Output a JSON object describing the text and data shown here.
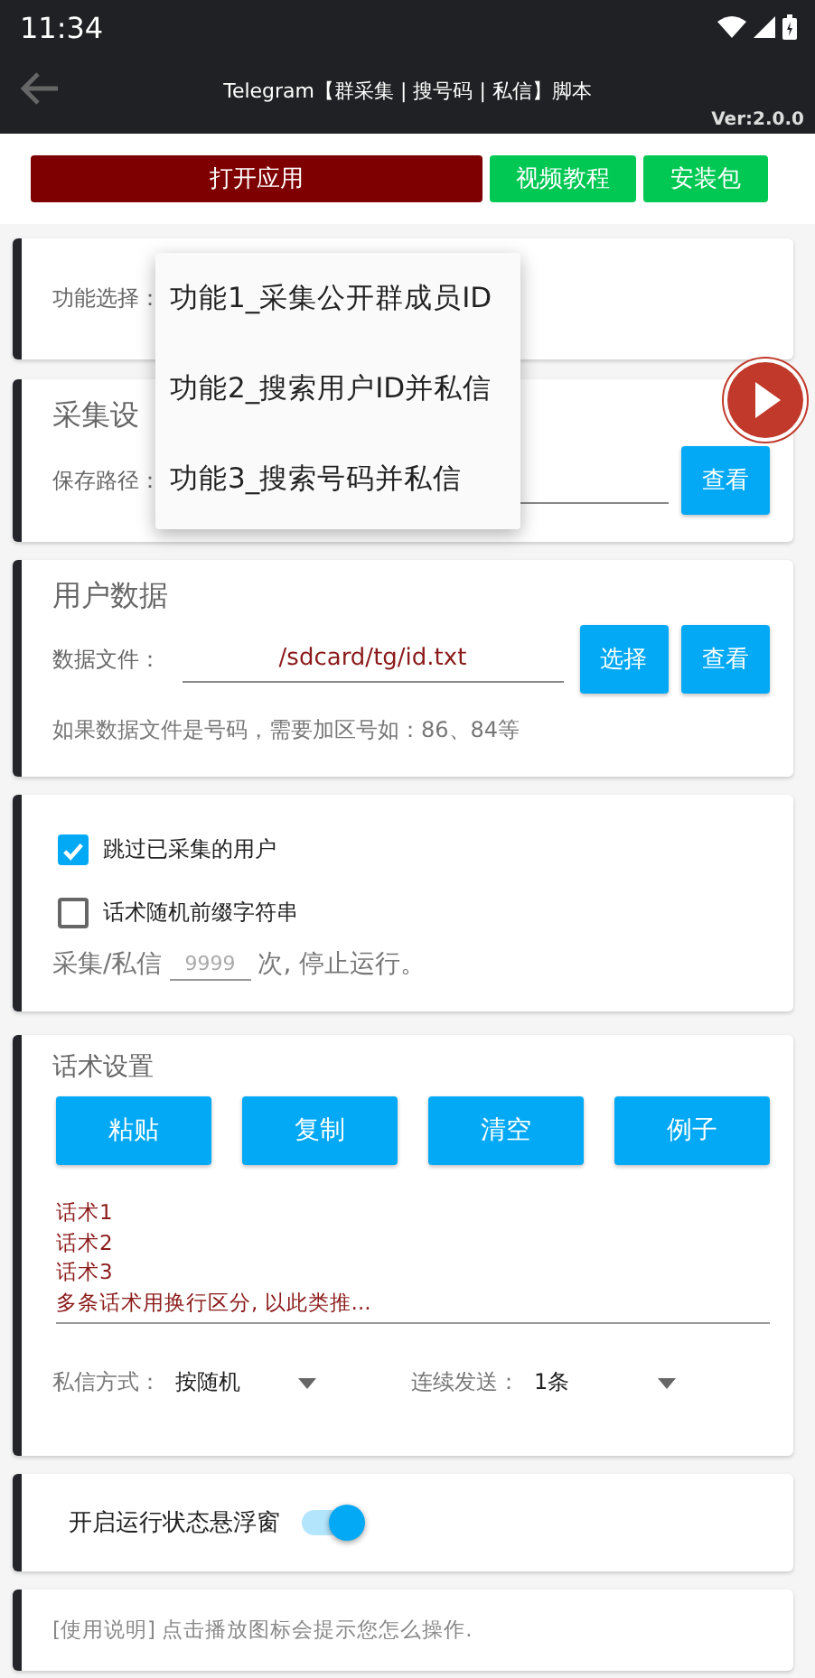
{
  "status_bar": {
    "time": "11:34"
  },
  "app_bar": {
    "title": "Telegram【群采集 | 搜号码 | 私信】脚本",
    "version": "Ver:2.0.0"
  },
  "top_buttons": [
    {
      "label": "打开应用",
      "kind": "primary"
    },
    {
      "label": "视频教程",
      "kind": "success"
    },
    {
      "label": "安装包",
      "kind": "success"
    }
  ],
  "function_card": {
    "label": "功能选择："
  },
  "dropdown_menu": {
    "items": [
      {
        "label": "功能1_采集公开群成员ID"
      },
      {
        "label": "功能2_搜索用户ID并私信"
      },
      {
        "label": "功能3_搜索号码并私信"
      }
    ]
  },
  "collect_settings": {
    "title": "采集设",
    "path_label": "保存路径：",
    "view_button": "查看"
  },
  "user_data": {
    "title": "用户数据",
    "file_label": "数据文件：",
    "file_value": "/sdcard/tg/id.txt",
    "buttons": [
      "选择",
      "查看"
    ],
    "hint": "如果数据文件是号码，需要加区号如：86、84等"
  },
  "options": {
    "checkboxes": [
      {
        "label": "跳过已采集的用户",
        "checked": true
      },
      {
        "label": "话术随机前缀字符串",
        "checked": false
      }
    ],
    "limit": {
      "prefix": "采集/私信",
      "placeholder": "9999",
      "suffix": "次, 停止运行。"
    }
  },
  "script_settings": {
    "title": "话术设置",
    "buttons": [
      "粘贴",
      "复制",
      "清空",
      "例子"
    ],
    "message": "话术1\n话术2\n话术3\n多条话术用换行区分, 以此类推...",
    "selects": [
      {
        "label": "私信方式：",
        "value": "按随机"
      },
      {
        "label": "连续发送：",
        "value": "1条"
      }
    ]
  },
  "float_toggle": {
    "label": "开启运行状态悬浮窗",
    "on": true
  },
  "usage": {
    "text": "[使用说明] 点击播放图标会提示您怎么操作."
  }
}
